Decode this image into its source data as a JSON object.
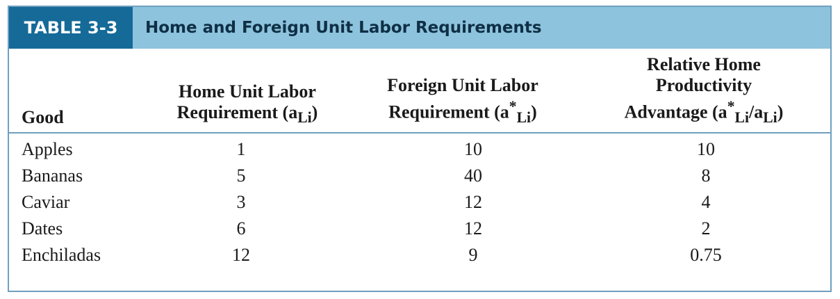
{
  "header": {
    "tag": "TABLE 3-3",
    "title": "Home and Foreign Unit Labor Requirements"
  },
  "columns": {
    "good": "Good",
    "home": {
      "line1": "Home Unit Labor",
      "line2": "Requirement (a",
      "sub": "Li",
      "close": ")"
    },
    "foreign": {
      "line1": "Foreign Unit Labor",
      "line2": "Requirement (a",
      "sup": "*",
      "sub": "Li",
      "close": ")"
    },
    "relative": {
      "line1": "Relative Home",
      "line2": "Productivity",
      "line3": "Advantage (a",
      "sup": "*",
      "sub": "Li",
      "slash": "/a",
      "sub2": "Li",
      "close": ")"
    }
  },
  "rows": [
    {
      "good": "Apples",
      "home": "1",
      "foreign": "10",
      "relative": "10"
    },
    {
      "good": "Bananas",
      "home": "5",
      "foreign": "40",
      "relative": "8"
    },
    {
      "good": "Caviar",
      "home": "3",
      "foreign": "12",
      "relative": "4"
    },
    {
      "good": "Dates",
      "home": "6",
      "foreign": "12",
      "relative": "2"
    },
    {
      "good": "Enchiladas",
      "home": "12",
      "foreign": "9",
      "relative": "0.75"
    }
  ]
}
